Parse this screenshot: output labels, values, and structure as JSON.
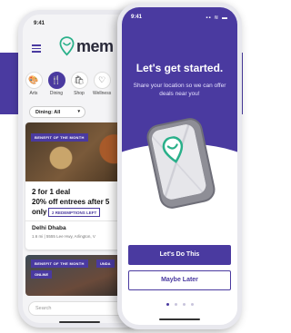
{
  "back_phone": {
    "time": "9:41",
    "logo_text": "mem",
    "categories": [
      {
        "label": "Arts",
        "icon": "palette-icon",
        "glyph": "🎨",
        "active": false
      },
      {
        "label": "Dining",
        "icon": "fork-knife-icon",
        "glyph": "🍴",
        "active": true
      },
      {
        "label": "Shop",
        "icon": "shopping-bag-icon",
        "glyph": "🛍",
        "active": false
      },
      {
        "label": "Wellness",
        "icon": "heart-icon",
        "glyph": "♡",
        "active": false
      }
    ],
    "filter": {
      "label": "Dining: All"
    },
    "deal_card": {
      "badge": "BENEFIT OF THE MONTH",
      "line1": "2 for 1 deal",
      "line2": "20% off entrees after 5",
      "line3": "only",
      "redemptions": "2 REDEMPTIONS LEFT",
      "venue_name": "Delhi Dhaba",
      "venue_address": "1.6 mi | 5555 Lee Hwy, Arlington, V"
    },
    "second_card": {
      "badge": "BENEFIT OF THE MONTH",
      "badge2": "UNDA",
      "badge3": "ONLINE"
    },
    "search": {
      "placeholder": "Search"
    }
  },
  "front_phone": {
    "time": "9:41",
    "status_icons": "▪▪ ≋ ▬",
    "title": "Let's get started.",
    "subtitle": "Share your location so we can offer deals near you!",
    "primary_button": "Let's Do This",
    "secondary_button": "Maybe Later",
    "pagination": {
      "total": 4,
      "active_index": 0
    }
  },
  "colors": {
    "brand_purple": "#4a3aa0",
    "brand_teal": "#2ab08a"
  }
}
